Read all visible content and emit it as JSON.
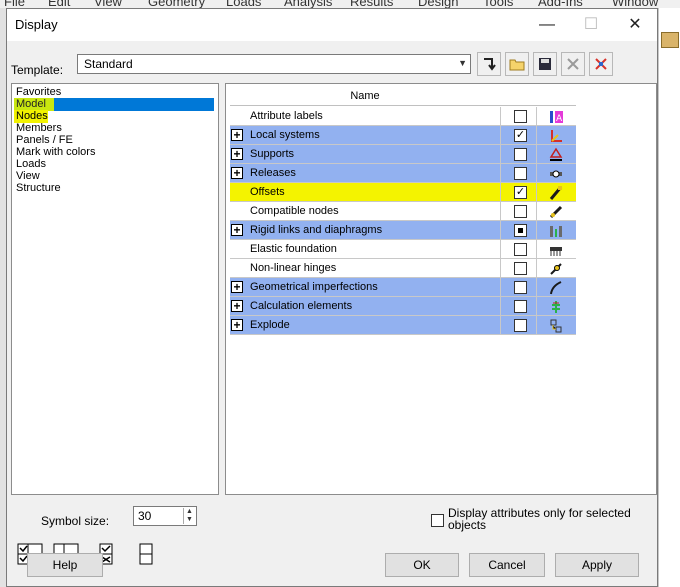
{
  "background_app": {
    "menu": [
      "File",
      "Edit",
      "View",
      "Geometry",
      "Loads",
      "Analysis",
      "Results",
      "Design",
      "Tools",
      "Add-Ins",
      "Window"
    ]
  },
  "dialog": {
    "title": "Display",
    "controls": {
      "minimize": "—",
      "maximize": "☐",
      "close": "✕"
    }
  },
  "template": {
    "label": "Template:",
    "value": "Standard",
    "tools": [
      "apply-arrow-icon",
      "open-folder-icon",
      "save-disk-icon",
      "delete-x-icon",
      "delete-all-icon"
    ]
  },
  "tree": {
    "items": [
      {
        "label": "Favorites",
        "selected": false,
        "highlighted": false
      },
      {
        "label": "Model",
        "selected": true,
        "highlighted": true
      },
      {
        "label": "Nodes",
        "selected": false,
        "highlighted": true
      },
      {
        "label": "Members",
        "selected": false,
        "highlighted": false
      },
      {
        "label": "Panels / FE",
        "selected": false,
        "highlighted": false
      },
      {
        "label": "Mark with colors",
        "selected": false,
        "highlighted": false
      },
      {
        "label": "Loads",
        "selected": false,
        "highlighted": false
      },
      {
        "label": "View",
        "selected": false,
        "highlighted": false
      },
      {
        "label": "Structure",
        "selected": false,
        "highlighted": false
      }
    ],
    "buttons": [
      "check-all-icon",
      "uncheck-all-icon",
      "check-selected-icon",
      "uncheck-icon"
    ]
  },
  "grid": {
    "header": "Name",
    "rows": [
      {
        "name": "Attribute labels",
        "expandable": false,
        "group": false,
        "state": "unchecked",
        "icon": "attribute-labels-icon",
        "highlight": false
      },
      {
        "name": "Local systems",
        "expandable": true,
        "group": true,
        "state": "checked",
        "icon": "local-systems-icon",
        "highlight": false
      },
      {
        "name": "Supports",
        "expandable": true,
        "group": true,
        "state": "unchecked",
        "icon": "supports-icon",
        "highlight": false
      },
      {
        "name": "Releases",
        "expandable": true,
        "group": true,
        "state": "unchecked",
        "icon": "releases-icon",
        "highlight": false
      },
      {
        "name": "Offsets",
        "expandable": false,
        "group": false,
        "state": "checked",
        "icon": "offsets-icon",
        "highlight": true
      },
      {
        "name": "Compatible nodes",
        "expandable": false,
        "group": false,
        "state": "unchecked",
        "icon": "compatible-nodes-icon",
        "highlight": false
      },
      {
        "name": "Rigid links and diaphragms",
        "expandable": true,
        "group": true,
        "state": "indeterminate",
        "icon": "rigid-links-icon",
        "highlight": false
      },
      {
        "name": "Elastic foundation",
        "expandable": false,
        "group": false,
        "state": "unchecked",
        "icon": "elastic-foundation-icon",
        "highlight": false
      },
      {
        "name": "Non-linear hinges",
        "expandable": false,
        "group": false,
        "state": "unchecked",
        "icon": "nonlinear-hinges-icon",
        "highlight": false
      },
      {
        "name": "Geometrical imperfections",
        "expandable": true,
        "group": true,
        "state": "unchecked",
        "icon": "imperfections-icon",
        "highlight": false
      },
      {
        "name": "Calculation elements",
        "expandable": true,
        "group": true,
        "state": "unchecked",
        "icon": "calculation-elements-icon",
        "highlight": false
      },
      {
        "name": "Explode",
        "expandable": true,
        "group": true,
        "state": "unchecked",
        "icon": "explode-icon",
        "highlight": false
      }
    ]
  },
  "symbol_size": {
    "label": "Symbol size:",
    "value": "30"
  },
  "display_selected": {
    "label": "Display attributes only for selected objects",
    "checked": false
  },
  "buttons": {
    "help": "Help",
    "ok": "OK",
    "cancel": "Cancel",
    "apply": "Apply"
  },
  "colors": {
    "selection": "#0078d7",
    "group_row": "#92b1f0",
    "marker": "#f4f300"
  }
}
